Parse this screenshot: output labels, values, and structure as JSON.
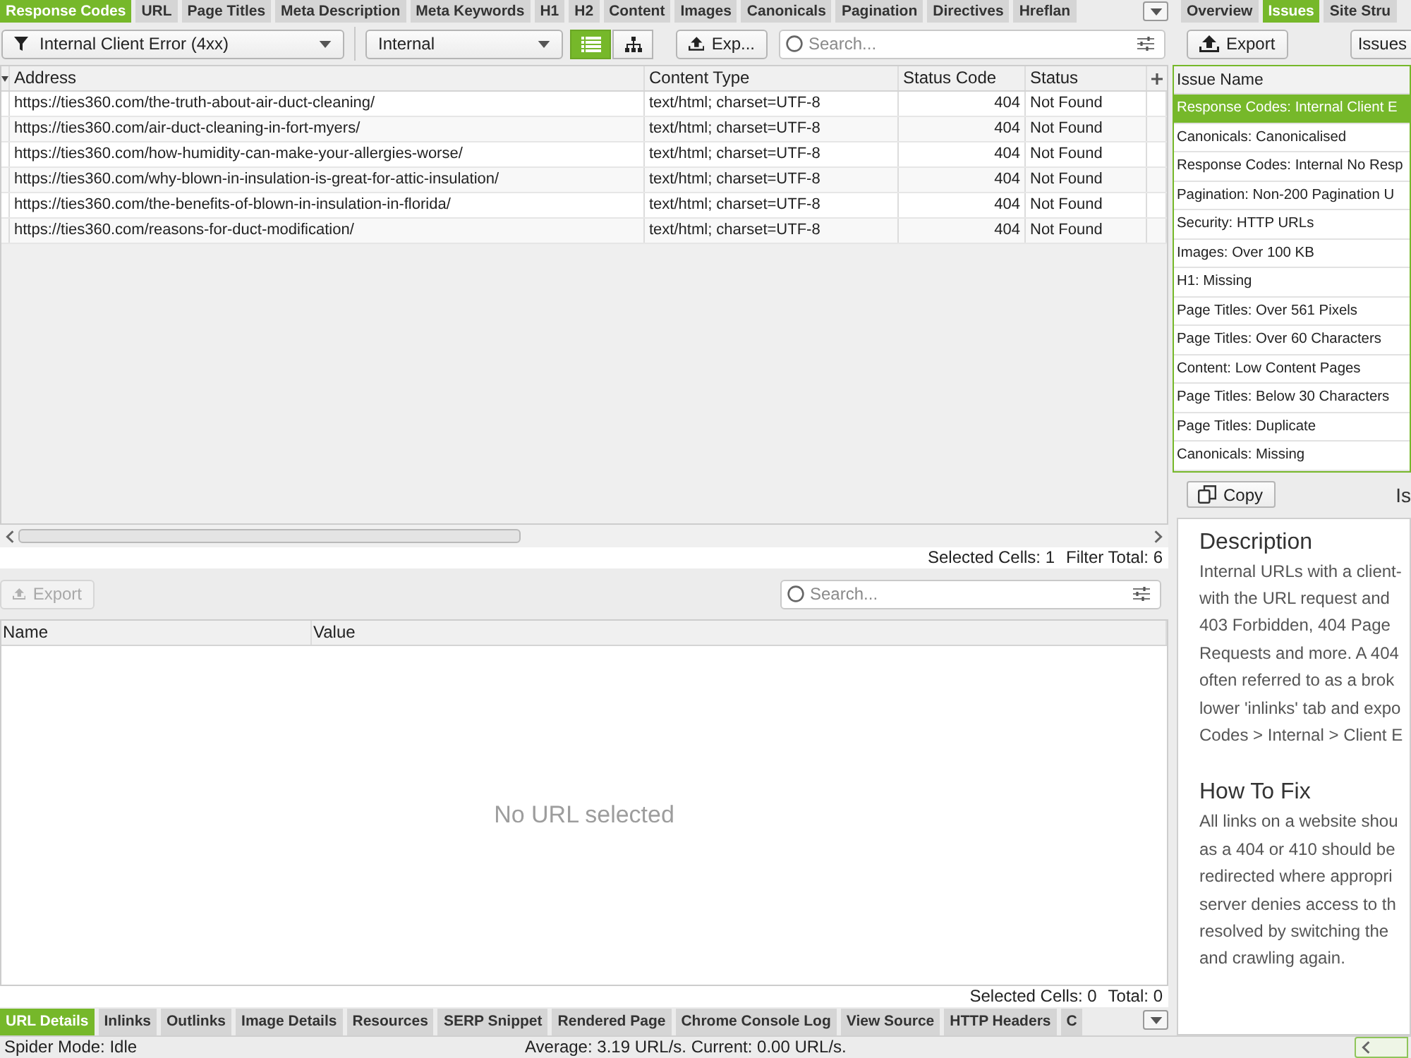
{
  "top_tabs": [
    {
      "label": "Response Codes",
      "selected": true
    },
    {
      "label": "URL",
      "selected": false
    },
    {
      "label": "Page Titles",
      "selected": false
    },
    {
      "label": "Meta Description",
      "selected": false
    },
    {
      "label": "Meta Keywords",
      "selected": false
    },
    {
      "label": "H1",
      "selected": false
    },
    {
      "label": "H2",
      "selected": false
    },
    {
      "label": "Content",
      "selected": false
    },
    {
      "label": "Images",
      "selected": false
    },
    {
      "label": "Canonicals",
      "selected": false
    },
    {
      "label": "Pagination",
      "selected": false
    },
    {
      "label": "Directives",
      "selected": false
    },
    {
      "label": "Hreflan",
      "selected": false
    }
  ],
  "toolbar": {
    "filter": "Internal Client Error (4xx)",
    "scope": "Internal",
    "views": [
      {
        "kind": "list",
        "selected": true
      },
      {
        "kind": "tree",
        "selected": false
      }
    ],
    "export": "Exp...",
    "search": {
      "placeholder": "Search..."
    }
  },
  "table": {
    "columns": [
      "Address",
      "Content Type",
      "Status Code",
      "Status"
    ],
    "rows": [
      {
        "address": "https://ties360.com/the-truth-about-air-duct-cleaning/",
        "content_type": "text/html; charset=UTF-8",
        "status_code": "404",
        "status": "Not Found"
      },
      {
        "address": "https://ties360.com/air-duct-cleaning-in-fort-myers/",
        "content_type": "text/html; charset=UTF-8",
        "status_code": "404",
        "status": "Not Found"
      },
      {
        "address": "https://ties360.com/how-humidity-can-make-your-allergies-worse/",
        "content_type": "text/html; charset=UTF-8",
        "status_code": "404",
        "status": "Not Found"
      },
      {
        "address": "https://ties360.com/why-blown-in-insulation-is-great-for-attic-insulation/",
        "content_type": "text/html; charset=UTF-8",
        "status_code": "404",
        "status": "Not Found"
      },
      {
        "address": "https://ties360.com/the-benefits-of-blown-in-insulation-in-florida/",
        "content_type": "text/html; charset=UTF-8",
        "status_code": "404",
        "status": "Not Found"
      },
      {
        "address": "https://ties360.com/reasons-for-duct-modification/",
        "content_type": "text/html; charset=UTF-8",
        "status_code": "404",
        "status": "Not Found"
      }
    ]
  },
  "table_footer": {
    "selected_cells": "Selected Cells: 1",
    "filter_total": "Filter Total: 6"
  },
  "details": {
    "export": {
      "label": "Export",
      "disabled": true
    },
    "search": {
      "placeholder": "Search..."
    },
    "columns": [
      "Name",
      "Value"
    ],
    "empty_message": "No URL selected",
    "footer": {
      "selected_cells": "Selected Cells: 0",
      "total": "Total: 0"
    }
  },
  "bottom_tabs": [
    {
      "label": "URL Details",
      "selected": true
    },
    {
      "label": "Inlinks",
      "selected": false
    },
    {
      "label": "Outlinks",
      "selected": false
    },
    {
      "label": "Image Details",
      "selected": false
    },
    {
      "label": "Resources",
      "selected": false
    },
    {
      "label": "SERP Snippet",
      "selected": false
    },
    {
      "label": "Rendered Page",
      "selected": false
    },
    {
      "label": "Chrome Console Log",
      "selected": false
    },
    {
      "label": "View Source",
      "selected": false
    },
    {
      "label": "HTTP Headers",
      "selected": false
    },
    {
      "label": "C",
      "selected": false
    }
  ],
  "right_panel": {
    "tabs": [
      {
        "label": "Overview",
        "selected": false
      },
      {
        "label": "Issues",
        "selected": true
      },
      {
        "label": "Site Stru",
        "selected": false
      }
    ],
    "export": "Export",
    "issues_button": "Issues",
    "issues": {
      "column": "Issue Name",
      "rows": [
        {
          "name": "Response Codes: Internal Client E",
          "selected": true
        },
        {
          "name": "Canonicals: Canonicalised",
          "selected": false
        },
        {
          "name": "Response Codes: Internal No Resp",
          "selected": false
        },
        {
          "name": "Pagination: Non-200 Pagination U",
          "selected": false
        },
        {
          "name": "Security: HTTP URLs",
          "selected": false
        },
        {
          "name": "Images: Over 100 KB",
          "selected": false
        },
        {
          "name": "H1: Missing",
          "selected": false
        },
        {
          "name": "Page Titles: Over 561 Pixels",
          "selected": false
        },
        {
          "name": "Page Titles: Over 60 Characters",
          "selected": false
        },
        {
          "name": "Content: Low Content Pages",
          "selected": false
        },
        {
          "name": "Page Titles: Below 30 Characters",
          "selected": false
        },
        {
          "name": "Page Titles: Duplicate",
          "selected": false
        },
        {
          "name": "Canonicals: Missing",
          "selected": false
        }
      ]
    },
    "copy": "Copy",
    "heading": "Is",
    "description": {
      "title": "Description",
      "lines": [
        "Internal URLs with a client-",
        "with the URL request and",
        "403 Forbidden, 404 Page",
        "Requests and more. A 404",
        "often referred to as a brok",
        "lower 'inlinks' tab and expo",
        "Codes > Internal > Client E"
      ]
    },
    "how_to_fix": {
      "title": "How To Fix",
      "lines": [
        "All links on a website shou",
        "as a 404 or 410 should be",
        "redirected where appropri",
        "server denies access to th",
        "resolved by switching the",
        "and crawling again."
      ]
    }
  },
  "status_bar": {
    "mode": "Spider Mode: Idle",
    "speed": "Average: 3.19 URL/s. Current: 0.00 URL/s."
  }
}
